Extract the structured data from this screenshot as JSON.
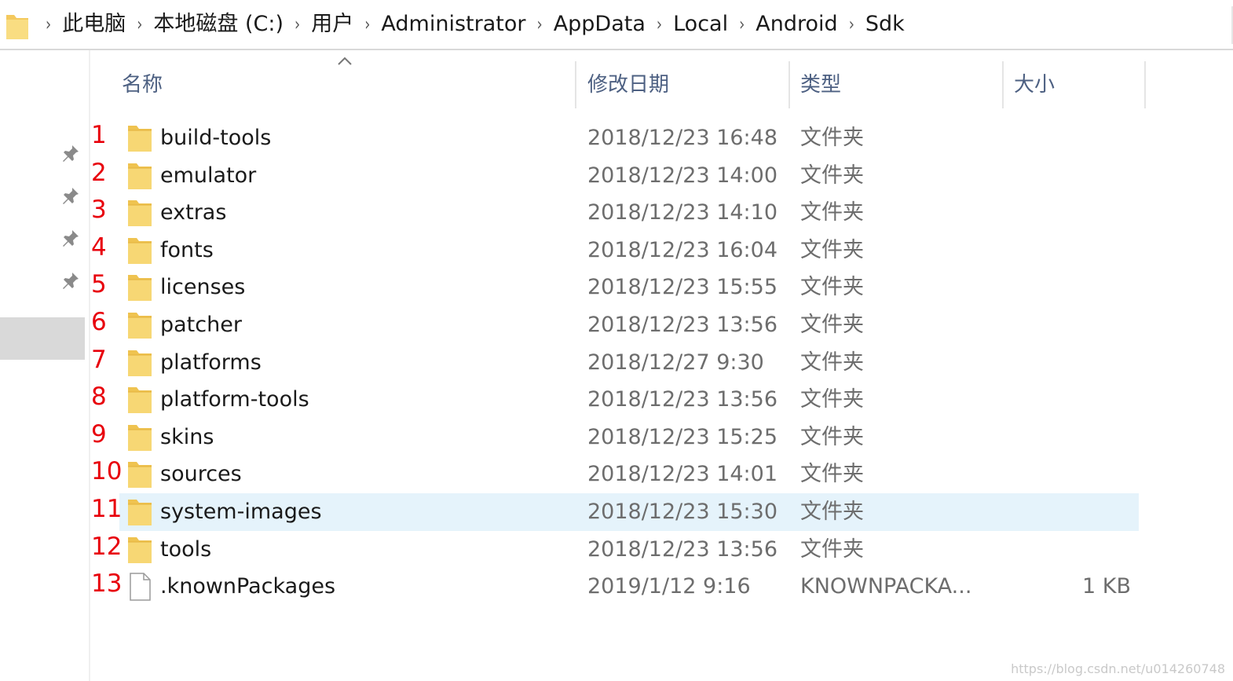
{
  "address_bar": {
    "crumbs": [
      "此电脑",
      "本地磁盘 (C:)",
      "用户",
      "Administrator",
      "AppData",
      "Local",
      "Android",
      "Sdk"
    ],
    "separator": "›"
  },
  "columns": {
    "name": "名称",
    "date": "修改日期",
    "type": "类型",
    "size": "大小"
  },
  "files": [
    {
      "index": "1",
      "name": "build-tools",
      "date": "2018/12/23 16:48",
      "type": "文件夹",
      "size": "",
      "kind": "folder"
    },
    {
      "index": "2",
      "name": "emulator",
      "date": "2018/12/23 14:00",
      "type": "文件夹",
      "size": "",
      "kind": "folder"
    },
    {
      "index": "3",
      "name": "extras",
      "date": "2018/12/23 14:10",
      "type": "文件夹",
      "size": "",
      "kind": "folder"
    },
    {
      "index": "4",
      "name": "fonts",
      "date": "2018/12/23 16:04",
      "type": "文件夹",
      "size": "",
      "kind": "folder"
    },
    {
      "index": "5",
      "name": "licenses",
      "date": "2018/12/23 15:55",
      "type": "文件夹",
      "size": "",
      "kind": "folder"
    },
    {
      "index": "6",
      "name": "patcher",
      "date": "2018/12/23 13:56",
      "type": "文件夹",
      "size": "",
      "kind": "folder"
    },
    {
      "index": "7",
      "name": "platforms",
      "date": "2018/12/27 9:30",
      "type": "文件夹",
      "size": "",
      "kind": "folder"
    },
    {
      "index": "8",
      "name": "platform-tools",
      "date": "2018/12/23 13:56",
      "type": "文件夹",
      "size": "",
      "kind": "folder"
    },
    {
      "index": "9",
      "name": "skins",
      "date": "2018/12/23 15:25",
      "type": "文件夹",
      "size": "",
      "kind": "folder"
    },
    {
      "index": "10",
      "name": "sources",
      "date": "2018/12/23 14:01",
      "type": "文件夹",
      "size": "",
      "kind": "folder"
    },
    {
      "index": "11",
      "name": "system-images",
      "date": "2018/12/23 15:30",
      "type": "文件夹",
      "size": "",
      "kind": "folder",
      "selected": true
    },
    {
      "index": "12",
      "name": "tools",
      "date": "2018/12/23 13:56",
      "type": "文件夹",
      "size": "",
      "kind": "folder"
    },
    {
      "index": "13",
      "name": ".knownPackages",
      "date": "2019/1/12 9:16",
      "type": "KNOWNPACKA...",
      "size": "1 KB",
      "kind": "file"
    }
  ],
  "watermark": "https://blog.csdn.net/u014260748",
  "colors": {
    "index_label": "#e8000b",
    "selected_row": "#e5f3fb",
    "folder": "#f7d774",
    "header_text": "#4d6082"
  }
}
